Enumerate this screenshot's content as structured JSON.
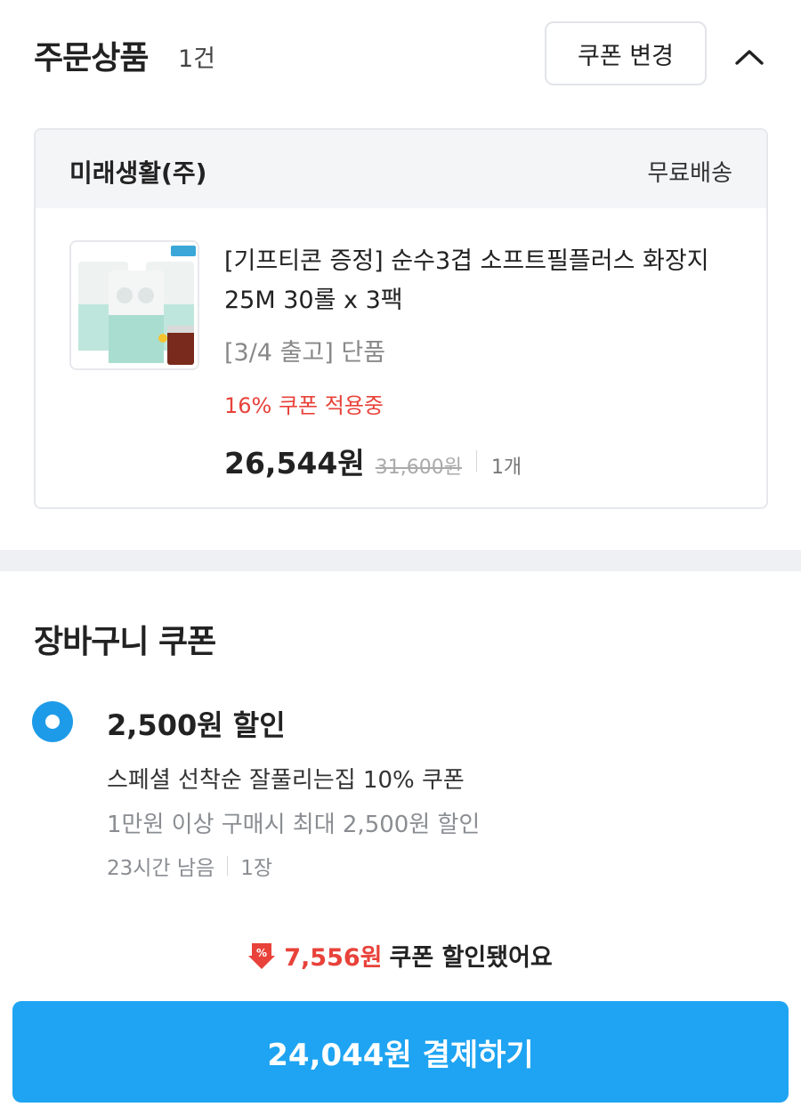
{
  "order": {
    "title": "주문상품",
    "count": "1건",
    "coupon_change_label": "쿠폰 변경",
    "collapse_icon": "chevron-up-icon"
  },
  "seller": {
    "name": "미래생활(주)",
    "shipping": "무료배송"
  },
  "product": {
    "name": "[기프티콘 증정] 순수3겹 소프트필플러스 화장지 25M 30롤 x 3팩",
    "option": "[3/4 출고] 단품",
    "coupon_status": "16% 쿠폰 적용중",
    "sale_price": "26,544원",
    "original_price": "31,600원",
    "quantity": "1개"
  },
  "cart_coupon": {
    "title": "장바구니 쿠폰",
    "selected": true,
    "amount": "2,500원 할인",
    "name": "스페셜 선착순 잘풀리는집 10% 쿠폰",
    "condition": "1만원 이상 구매시 최대 2,500원 할인",
    "time_left": "23시간 남음",
    "count": "1장"
  },
  "discount_notice": {
    "amount": "7,556원",
    "text": "쿠폰 할인됐어요"
  },
  "pay_button": {
    "label": "24,044원 결제하기"
  },
  "colors": {
    "accent": "#1ea4f2",
    "discount_red": "#e8423a"
  }
}
